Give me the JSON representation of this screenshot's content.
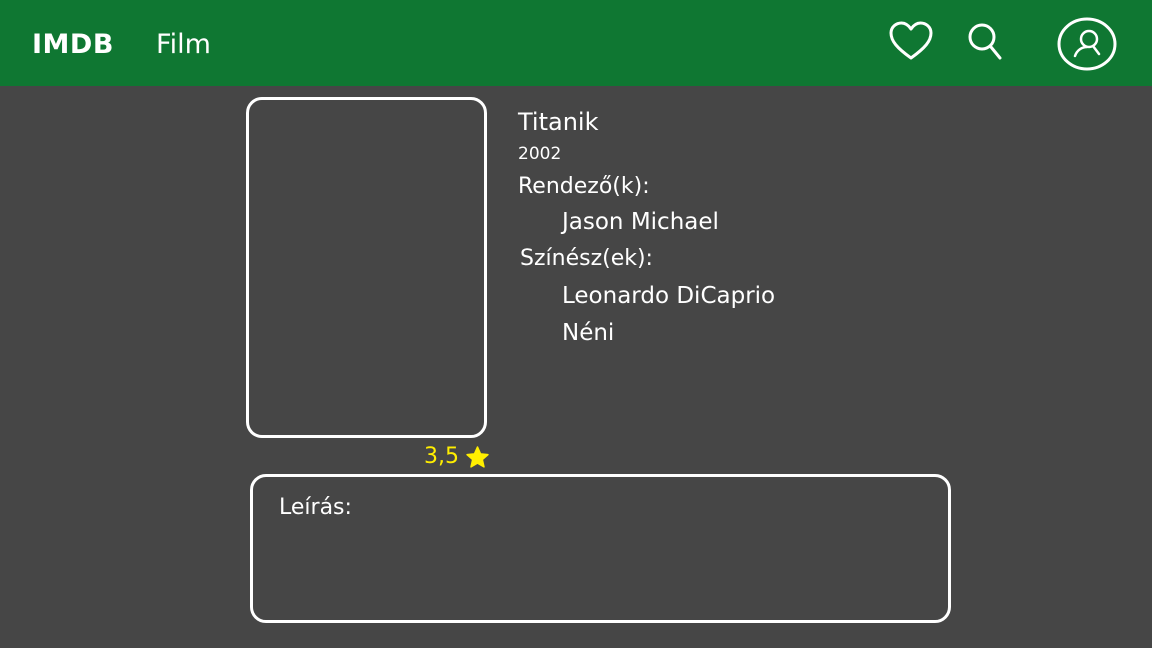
{
  "header": {
    "brand": "IMDB",
    "nav_film": "Film",
    "icons": [
      "heart-icon",
      "search-icon",
      "user-profile-icon"
    ],
    "background_color": "#0f7732"
  },
  "movie": {
    "title": "Titanik",
    "year": "2002",
    "directors_label": "Rendező(k):",
    "directors": [
      "Jason Michael"
    ],
    "actors_label": "Színész(ek):",
    "actors": [
      "Leonardo DiCaprio",
      "Néni"
    ],
    "rating": "3,5",
    "rating_icon": "star-icon",
    "rating_color": "#ffee00",
    "description_label": "Leírás:"
  },
  "page": {
    "background_color": "#464646"
  }
}
